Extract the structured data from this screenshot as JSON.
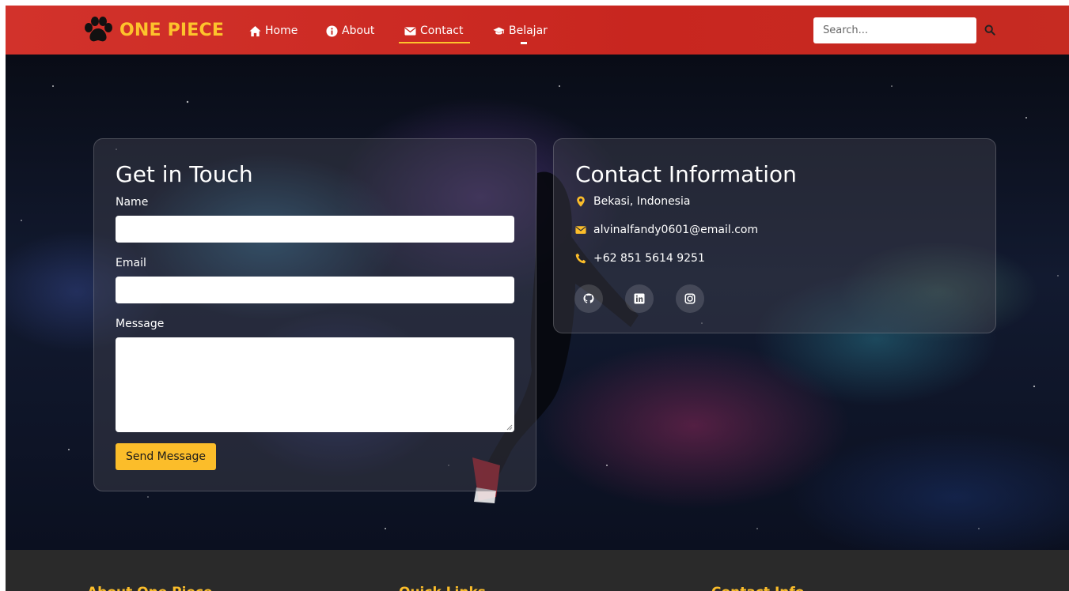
{
  "navbar": {
    "brand": "ONE PIECE",
    "items": [
      {
        "label": "Home",
        "icon": "home-icon"
      },
      {
        "label": "About",
        "icon": "info-circle-icon"
      },
      {
        "label": "Contact",
        "icon": "envelope-icon",
        "active": true
      },
      {
        "label": "Belajar",
        "icon": "graduation-cap-icon"
      }
    ],
    "search": {
      "placeholder": "Search...",
      "value": ""
    }
  },
  "form": {
    "title": "Get in Touch",
    "name_label": "Name",
    "email_label": "Email",
    "message_label": "Message",
    "name_value": "",
    "email_value": "",
    "message_value": "",
    "submit_label": "Send Message"
  },
  "info": {
    "title": "Contact Information",
    "location": "Bekasi, Indonesia",
    "email": "alvinalfandy0601@email.com",
    "phone": "+62 851 5614 9251",
    "socials": [
      "github-icon",
      "linkedin-icon",
      "instagram-icon"
    ]
  },
  "footer": {
    "headings": [
      "About One Piece",
      "Quick Links",
      "Contact Info"
    ]
  },
  "colors": {
    "navbar": "#d2322b",
    "accent": "#fbbd2a",
    "footer": "#2a2a2a"
  }
}
